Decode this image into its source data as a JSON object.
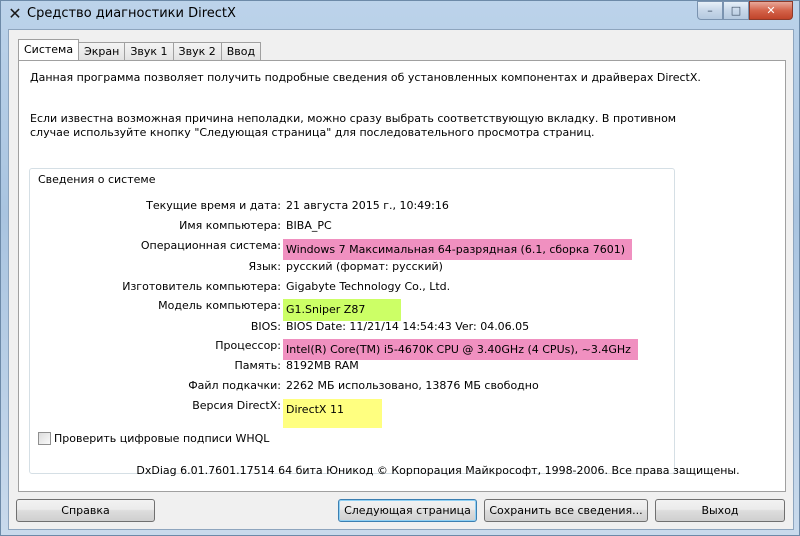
{
  "window": {
    "title": "Средство диагностики DirectX",
    "icon": "directx-x-icon",
    "caption_buttons": {
      "minimize": "–",
      "maximize": "□",
      "close": "✕"
    }
  },
  "tabs": [
    {
      "label": "Система",
      "active": true
    },
    {
      "label": "Экран",
      "active": false
    },
    {
      "label": "Звук 1",
      "active": false
    },
    {
      "label": "Звук 2",
      "active": false
    },
    {
      "label": "Ввод",
      "active": false
    }
  ],
  "intro": {
    "line1": "Данная программа позволяет получить подробные сведения об установленных компонентах и драйверах DirectX.",
    "line2": "Если известна возможная причина неполадки, можно сразу выбрать соответствующую вкладку. В противном случае используйте кнопку \"Следующая страница\" для последовательного просмотра страниц."
  },
  "system_info": {
    "group_title": "Сведения о системе",
    "rows": [
      {
        "label": "Текущие время и дата:",
        "value": "21 августа 2015 г., 10:49:16",
        "highlight": ""
      },
      {
        "label": "Имя компьютера:",
        "value": "BIBA_PC",
        "highlight": ""
      },
      {
        "label": "Операционная система:",
        "value": "Windows 7 Максимальная 64-разрядная (6.1, сборка 7601)",
        "highlight": "pink"
      },
      {
        "label": "Язык:",
        "value": "русский (формат: русский)",
        "highlight": ""
      },
      {
        "label": "Изготовитель компьютера:",
        "value": "Gigabyte Technology Co., Ltd.",
        "highlight": ""
      },
      {
        "label": "Модель компьютера:",
        "value": "G1.Sniper Z87",
        "highlight": "green"
      },
      {
        "label": "BIOS:",
        "value": "BIOS Date: 11/21/14 14:54:43 Ver: 04.06.05",
        "highlight": ""
      },
      {
        "label": "Процессор:",
        "value": "Intel(R) Core(TM) i5-4670K CPU @ 3.40GHz (4 CPUs), ~3.4GHz",
        "highlight": "pink"
      },
      {
        "label": "Память:",
        "value": "8192MB RAM",
        "highlight": ""
      },
      {
        "label": "Файл подкачки:",
        "value": "2262 МБ использовано, 13876 МБ свободно",
        "highlight": ""
      },
      {
        "label": "Версия DirectX:",
        "value": "DirectX 11",
        "highlight": "yellow"
      }
    ],
    "highlight_colors": {
      "pink": "#f090c0",
      "green": "#ccff66",
      "yellow": "#ffff80"
    }
  },
  "whql": {
    "label": "Проверить цифровые подписи WHQL",
    "checked": false
  },
  "footer_text": "DxDiag 6.01.7601.17514 64 бита Юникод  © Корпорация Майкрософт, 1998-2006.  Все права защищены.",
  "buttons": {
    "help": "Справка",
    "next": "Следующая страница",
    "save": "Сохранить все сведения...",
    "exit": "Выход"
  }
}
